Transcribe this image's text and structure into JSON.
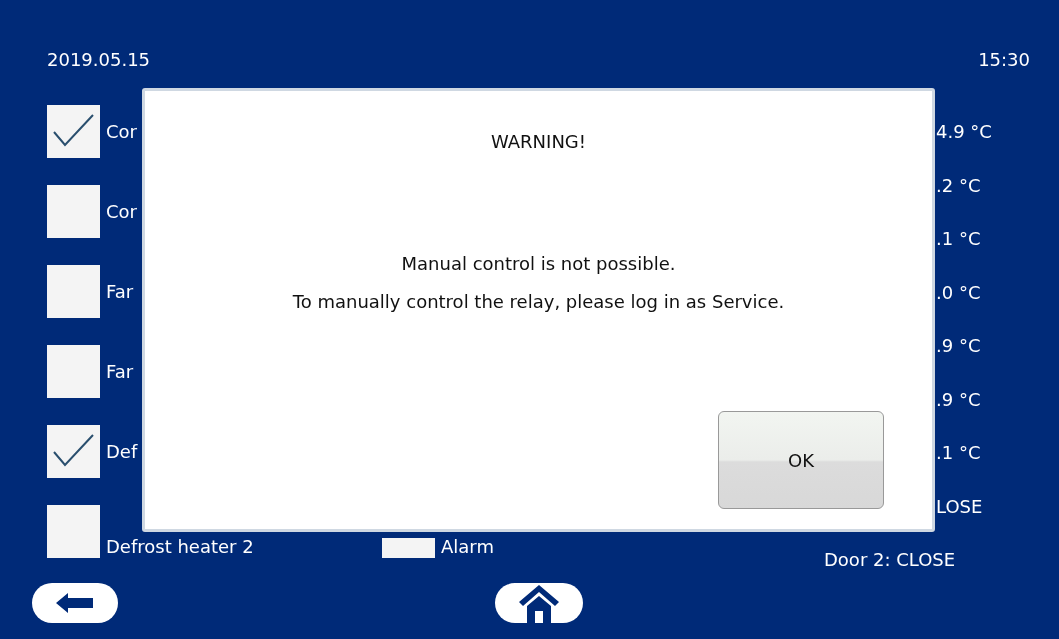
{
  "header": {
    "date": "2019.05.15",
    "time": "15:30"
  },
  "relays": [
    {
      "label": "Cor",
      "checked": true
    },
    {
      "label": "Cor",
      "checked": false
    },
    {
      "label": "Far",
      "checked": false
    },
    {
      "label": "Far",
      "checked": false
    },
    {
      "label": "Def",
      "checked": true
    },
    {
      "label": "Defrost heater 2",
      "checked": false
    }
  ],
  "alarm": {
    "label": "Alarm",
    "checked": false
  },
  "readings": [
    "4.9 °C",
    ".2 °C",
    ".1 °C",
    ".0 °C",
    ".9 °C",
    ".9 °C",
    ".1 °C",
    "LOSE"
  ],
  "door_2": "Door 2:  CLOSE",
  "dialog": {
    "title": "WARNING!",
    "message": [
      "Manual control is not possible.",
      "To manually control the relay, please log in as Service."
    ],
    "button": "OK"
  }
}
